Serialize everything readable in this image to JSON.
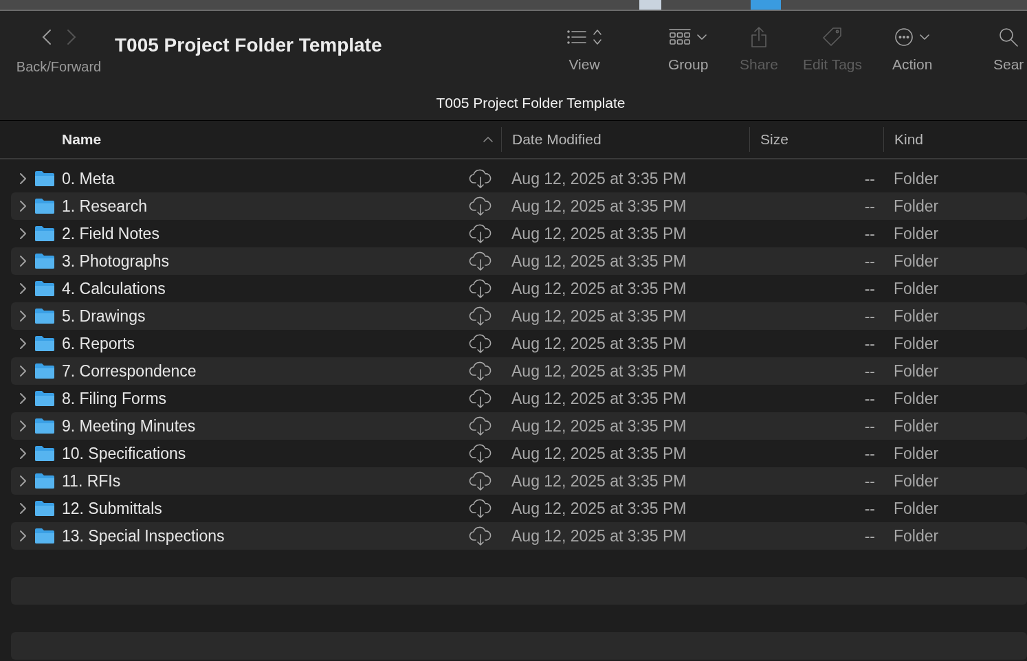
{
  "window": {
    "title": "T005 Project Folder Template",
    "path_title": "T005 Project Folder Template"
  },
  "navigation": {
    "label": "Back/Forward",
    "buttons": [
      {
        "kind": "back",
        "disabled": false
      },
      {
        "kind": "forward",
        "disabled": true
      }
    ]
  },
  "toolbar": [
    {
      "kind": "view",
      "label": "View",
      "disabled": false
    },
    {
      "kind": "group",
      "label": "Group",
      "disabled": false
    },
    {
      "kind": "share",
      "label": "Share",
      "disabled": true
    },
    {
      "kind": "tags",
      "label": "Edit Tags",
      "disabled": true
    },
    {
      "kind": "action",
      "label": "Action",
      "disabled": false
    },
    {
      "kind": "search",
      "label": "Sear",
      "disabled": false
    }
  ],
  "table": {
    "columns": [
      {
        "label": "Name",
        "sorted": true
      },
      {
        "label": "Date Modified",
        "sorted": false
      },
      {
        "label": "Size",
        "sorted": false
      },
      {
        "label": "Kind",
        "sorted": false
      }
    ],
    "rows": [
      {
        "name": "0. Meta",
        "date": "Aug 12, 2025 at 3:35 PM",
        "size": "--",
        "kind": "Folder"
      },
      {
        "name": "1. Research",
        "date": "Aug 12, 2025 at 3:35 PM",
        "size": "--",
        "kind": "Folder"
      },
      {
        "name": "2. Field Notes",
        "date": "Aug 12, 2025 at 3:35 PM",
        "size": "--",
        "kind": "Folder"
      },
      {
        "name": "3. Photographs",
        "date": "Aug 12, 2025 at 3:35 PM",
        "size": "--",
        "kind": "Folder"
      },
      {
        "name": "4. Calculations",
        "date": "Aug 12, 2025 at 3:35 PM",
        "size": "--",
        "kind": "Folder"
      },
      {
        "name": "5. Drawings",
        "date": "Aug 12, 2025 at 3:35 PM",
        "size": "--",
        "kind": "Folder"
      },
      {
        "name": "6. Reports",
        "date": "Aug 12, 2025 at 3:35 PM",
        "size": "--",
        "kind": "Folder"
      },
      {
        "name": "7. Correspondence",
        "date": "Aug 12, 2025 at 3:35 PM",
        "size": "--",
        "kind": "Folder"
      },
      {
        "name": "8. Filing Forms",
        "date": "Aug 12, 2025 at 3:35 PM",
        "size": "--",
        "kind": "Folder"
      },
      {
        "name": "9. Meeting Minutes",
        "date": "Aug 12, 2025 at 3:35 PM",
        "size": "--",
        "kind": "Folder"
      },
      {
        "name": "10. Specifications",
        "date": "Aug 12, 2025 at 3:35 PM",
        "size": "--",
        "kind": "Folder"
      },
      {
        "name": "11. RFIs",
        "date": "Aug 12, 2025 at 3:35 PM",
        "size": "--",
        "kind": "Folder"
      },
      {
        "name": "12. Submittals",
        "date": "Aug 12, 2025 at 3:35 PM",
        "size": "--",
        "kind": "Folder"
      },
      {
        "name": "13. Special Inspections",
        "date": "Aug 12, 2025 at 3:35 PM",
        "size": "--",
        "kind": "Folder"
      }
    ]
  }
}
